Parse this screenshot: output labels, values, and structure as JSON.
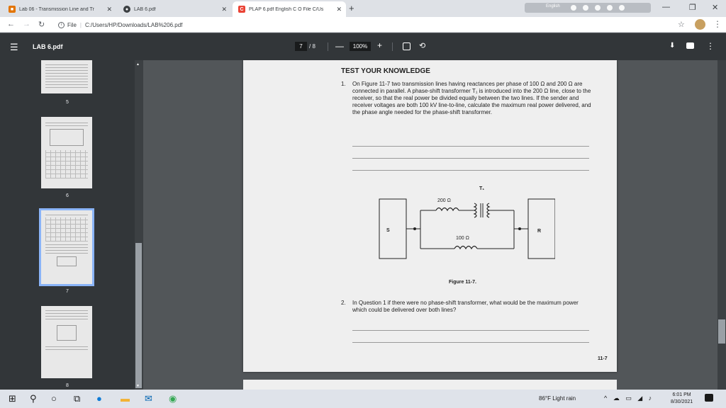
{
  "browser": {
    "tabs": [
      {
        "label": "Lab 06 - Transmission Line and Tr",
        "color": "#e37400",
        "glyph": "■"
      },
      {
        "label": "LAB 6.pdf",
        "color": "#3c4043",
        "glyph": "●"
      },
      {
        "label": "PLAP 6.pdf English C O File C/Us",
        "color": "#ea4335",
        "glyph": "C"
      }
    ],
    "ext_label": "English",
    "address": {
      "prefix": "File",
      "url": "C:/Users/HP/Downloads/LAB%206.pdf"
    }
  },
  "pdf": {
    "title": "LAB 6.pdf",
    "current_page": "7",
    "total_pages": "/ 8",
    "zoom": "100%"
  },
  "thumbnails": [
    {
      "number": "5"
    },
    {
      "number": "6"
    },
    {
      "number": "7"
    },
    {
      "number": "8"
    }
  ],
  "page": {
    "heading": "TEST YOUR KNOWLEDGE",
    "q1_num": "1.",
    "q1_text": "On Figure 11-7 two transmission lines having reactances per phase of 100 Ω and 200 Ω are connected in parallel. A phase-shift transformer T₁ is introduced into the 200 Ω line, close to the receiver, so that the real power be divided equally between the two lines. If the sender and receiver voltages are both 100 kV line-to-line, calculate the maximum real power delivered, and the phase angle needed for the phase-shift transformer.",
    "figure": {
      "sender": "S",
      "receiver": "R",
      "transformer": "T₁",
      "upper_reactance": "200 Ω",
      "lower_reactance": "100 Ω",
      "caption": "Figure 11-7."
    },
    "q2_num": "2.",
    "q2_text": "In Question 1 if there were no phase-shift transformer, what would be the maximum power which could be delivered over both lines?",
    "page_number": "11-7"
  },
  "taskbar": {
    "weather": "86°F  Light rain",
    "time": "6:01 PM",
    "date": "8/30/2021"
  }
}
